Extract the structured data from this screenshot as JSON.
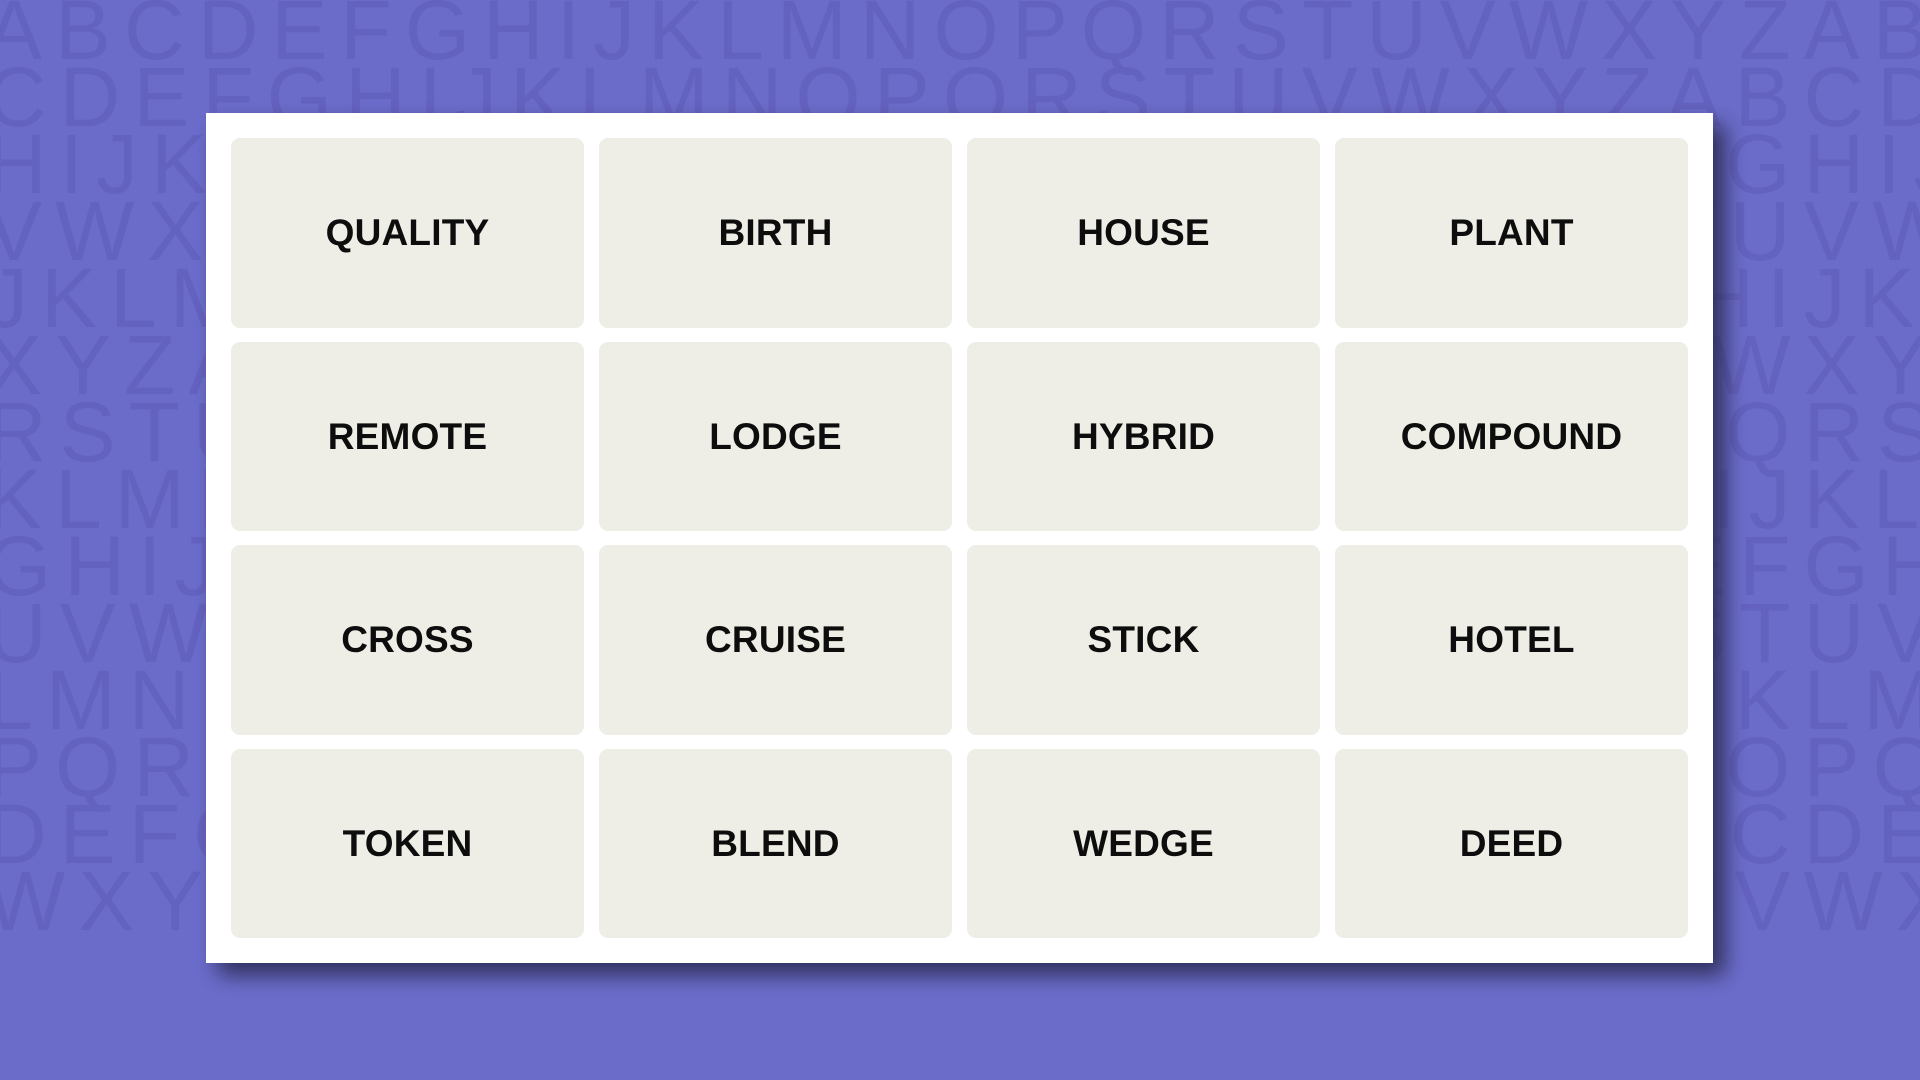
{
  "background": {
    "color": "#6b6cca",
    "letter_color": "#6462bf",
    "letter_rows": [
      "ABCDEFGHIJKLMNOPQRSTUVWXYZABCDEF",
      "CDEFGHIJKLMNOPQRSTUVWXYZABCDEFG",
      "HIJKLMNOPQRSTUVWXYZABCDEFGHIJKLM",
      "VWXYZABCDEFGHIJKLMNOPQRSTUVWXYZAB",
      "JKLMNOPQRSTUVWXYZABCDEFGHIJKLMNO",
      "XYZABCDEFGHIJKLMNOPQRSTUVWXYZABC",
      "RSTUVWXYZABCDEFGHIJKLMNOPQRSTUVW",
      "KLMNOPQRSTUVWXYZABCDEFGHIJKLMNOP",
      "GHIJKLMNOPQRSTUVWXYZABCDEFGHIJKL",
      "UVWXYZABCDEFGHIJKLMNOPQRSTUVWXY",
      "LMNOPQRSTUVWXYZABCDEFGHIJKLMNOP",
      "PQRSTUVWXYZABCDEFGHIJKLMNOPQRST",
      "DEFGHIJKLMNOPQRSTUVWXYZABCDEFGHI",
      "WXYZABCDEFGHIJKLMNOPQRSTUVWXYZA"
    ]
  },
  "card": {
    "background_color": "#ffffff",
    "shadow_color": "#2a2a52"
  },
  "grid": {
    "rows": 4,
    "columns": 4,
    "tile_color": "#eeeee6",
    "tile_text_color": "#0d0d0d",
    "tiles": [
      {
        "label": "QUALITY",
        "row": 1,
        "col": 1
      },
      {
        "label": "BIRTH",
        "row": 1,
        "col": 2
      },
      {
        "label": "HOUSE",
        "row": 1,
        "col": 3
      },
      {
        "label": "PLANT",
        "row": 1,
        "col": 4
      },
      {
        "label": "REMOTE",
        "row": 2,
        "col": 1
      },
      {
        "label": "LODGE",
        "row": 2,
        "col": 2
      },
      {
        "label": "HYBRID",
        "row": 2,
        "col": 3
      },
      {
        "label": "COMPOUND",
        "row": 2,
        "col": 4
      },
      {
        "label": "CROSS",
        "row": 3,
        "col": 1
      },
      {
        "label": "CRUISE",
        "row": 3,
        "col": 2
      },
      {
        "label": "STICK",
        "row": 3,
        "col": 3
      },
      {
        "label": "HOTEL",
        "row": 3,
        "col": 4
      },
      {
        "label": "TOKEN",
        "row": 4,
        "col": 1
      },
      {
        "label": "BLEND",
        "row": 4,
        "col": 2
      },
      {
        "label": "WEDGE",
        "row": 4,
        "col": 3
      },
      {
        "label": "DEED",
        "row": 4,
        "col": 4
      }
    ]
  }
}
